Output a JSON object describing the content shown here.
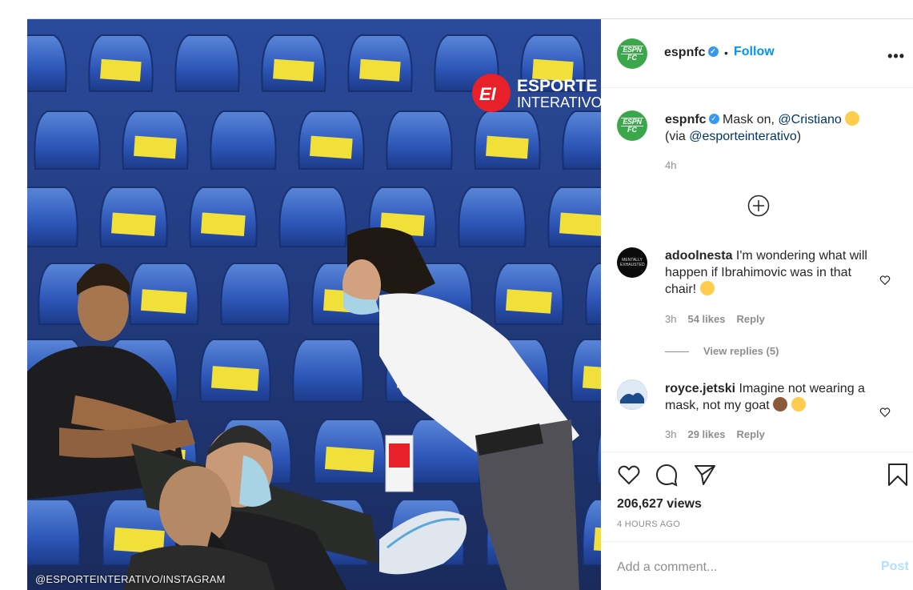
{
  "post": {
    "media": {
      "watermark_text": "@ESPORTEINTERATIVO/INSTAGRAM",
      "logo_text": "ESPORTE",
      "logo_text2": "INTERATIVO",
      "logo_mark": "EI"
    },
    "header": {
      "username": "espnfc",
      "separator": "•",
      "follow_label": "Follow",
      "more_label": "•••",
      "avatar_line1": "ESPN",
      "avatar_line2": "FC"
    },
    "caption": {
      "username": "espnfc",
      "text_before": "Mask on, ",
      "mention": "@Cristiano",
      "text_via": "(via ",
      "mention2": "@esporteinterativo",
      "text_after": ")",
      "time": "4h"
    },
    "comments": [
      {
        "username": "adoolnesta",
        "text": "I'm wondering what will happen if Ibrahimovic was in that chair!",
        "time": "3h",
        "likes": "54 likes",
        "reply_label": "Reply",
        "avatar_text": "MENTALLY EXHAUSTED"
      },
      {
        "username": "royce.jetski",
        "text": "Imagine not wearing a mask, not my goat",
        "time": "3h",
        "likes": "29 likes",
        "reply_label": "Reply"
      }
    ],
    "view_replies_label": "View replies (5)",
    "views": "206,627 views",
    "time_ago": "4 HOURS AGO",
    "add_comment_placeholder": "Add a comment...",
    "post_label": "Post",
    "colors": {
      "link": "#0095f6",
      "mention": "#00376b",
      "espn_green": "#3aa84a",
      "muted": "#8e8e8e",
      "seat_blue": "#2d56b8",
      "seat_label_yellow": "#f2e03a"
    },
    "icons": [
      "verified-icon",
      "more-icon",
      "add-circle-icon",
      "heart-icon",
      "comment-icon",
      "share-icon",
      "bookmark-icon"
    ]
  }
}
